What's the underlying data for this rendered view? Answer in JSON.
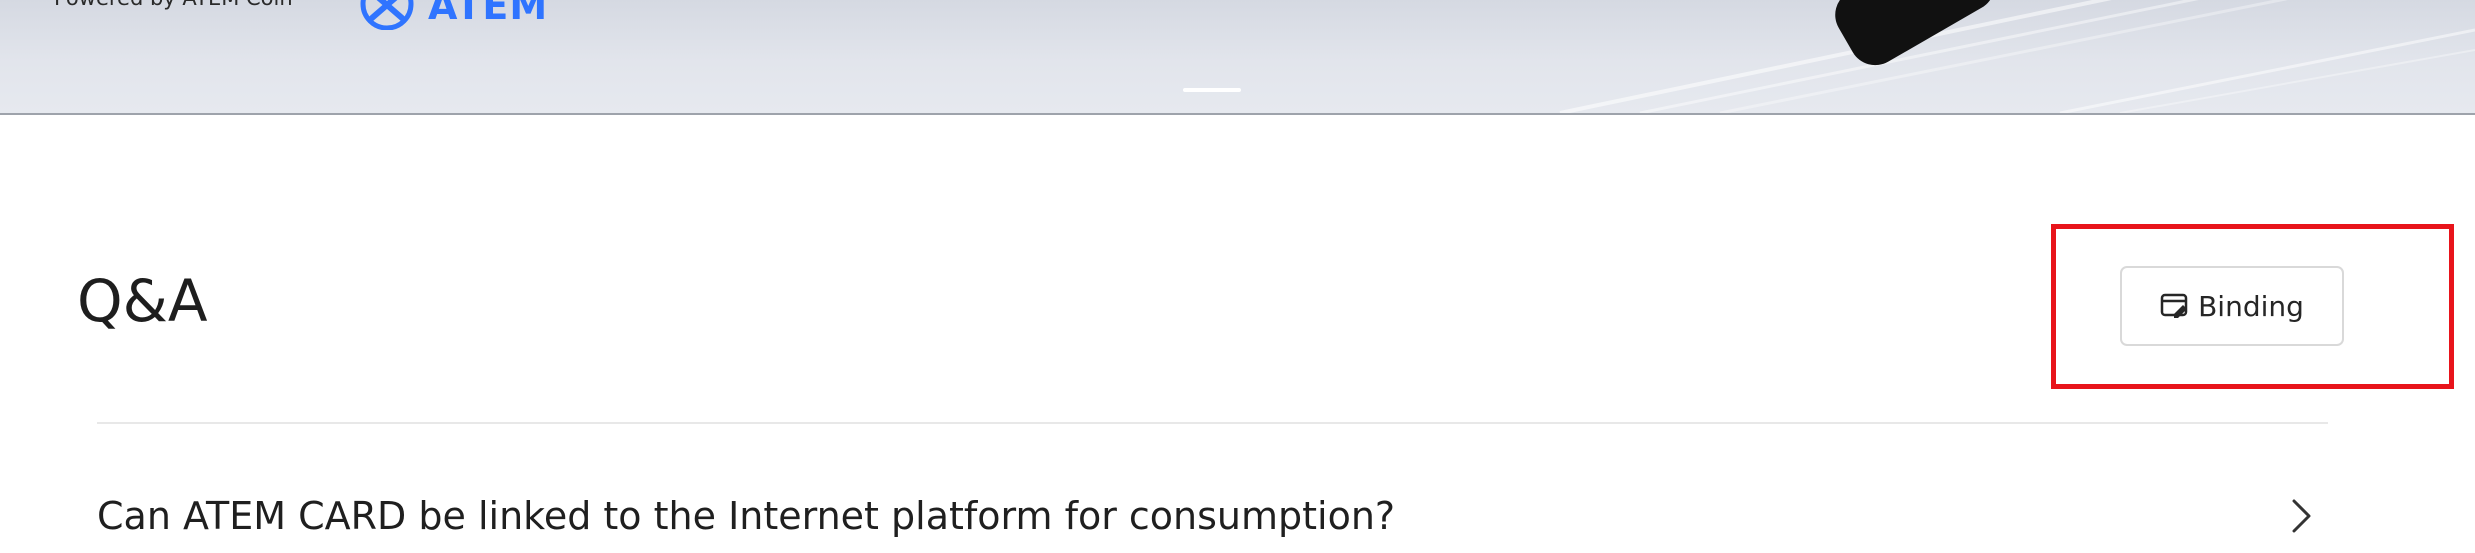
{
  "banner": {
    "powered_by": "Powered by ATEM Coin",
    "brand_name": "ATEM",
    "brand_color": "#2f74ff",
    "carousel_active_index": 0
  },
  "qa": {
    "title": "Q&A",
    "binding_button": {
      "label": "Binding",
      "icon": "card-edit-icon"
    },
    "highlight_color": "#e8141b",
    "items": [
      {
        "question": "Can ATEM CARD be linked to the Internet platform for consumption?",
        "icon": "chevron-right-icon"
      }
    ]
  }
}
